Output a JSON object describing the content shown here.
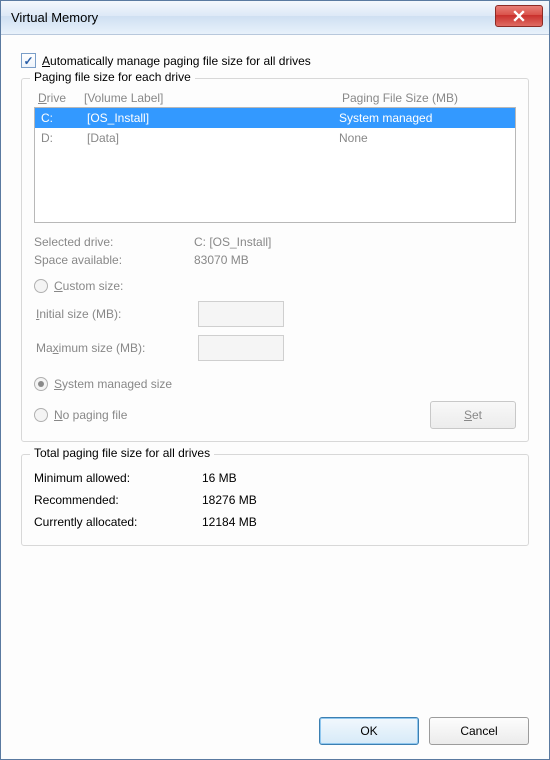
{
  "window": {
    "title": "Virtual Memory"
  },
  "auto_manage": {
    "checked": true,
    "label_pre": "A",
    "label_rest": "utomatically manage paging file size for all drives"
  },
  "drives_section": {
    "title": "Paging file size for each drive",
    "header_drive_pre": "D",
    "header_drive_rest": "rive",
    "header_label": "[Volume Label]",
    "header_size": "Paging File Size (MB)",
    "rows": [
      {
        "drive": "C:",
        "label": "[OS_Install]",
        "size": "System managed",
        "selected": true
      },
      {
        "drive": "D:",
        "label": "[Data]",
        "size": "None",
        "selected": false
      }
    ],
    "selected_label": "Selected drive:",
    "selected_value": "C:  [OS_Install]",
    "space_label": "Space available:",
    "space_value": "83070 MB"
  },
  "options": {
    "custom_pre": "C",
    "custom_rest": "ustom size:",
    "initial_pre": "I",
    "initial_rest": "nitial size (MB):",
    "max_label": "Maximum size (MB):",
    "system_pre": "S",
    "system_rest": "ystem managed size",
    "none_pre": "N",
    "none_rest": "o paging file",
    "set_pre": "S",
    "set_rest": "et"
  },
  "totals": {
    "title": "Total paging file size for all drives",
    "min_label": "Minimum allowed:",
    "min_value": "16 MB",
    "rec_label": "Recommended:",
    "rec_value": "18276 MB",
    "cur_label": "Currently allocated:",
    "cur_value": "12184 MB"
  },
  "buttons": {
    "ok": "OK",
    "cancel": "Cancel"
  }
}
